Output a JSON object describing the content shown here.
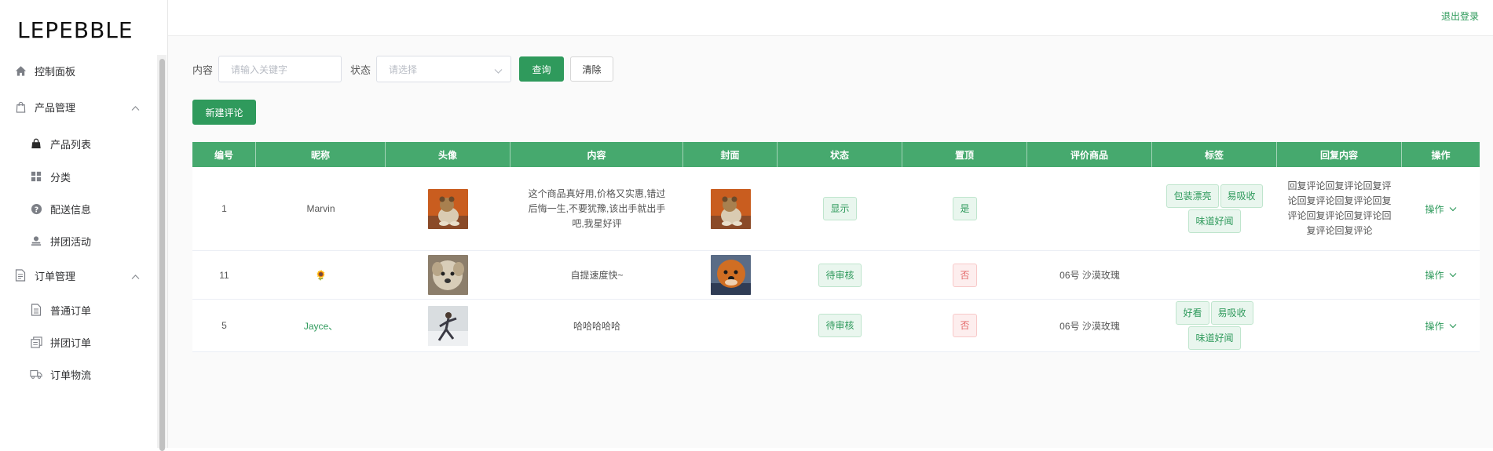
{
  "brand": {
    "logo": "LEPEBBLE"
  },
  "header": {
    "logout": "退出登录"
  },
  "sidebar": {
    "items": [
      {
        "label": "控制面板",
        "icon": "home-icon",
        "kind": "top"
      },
      {
        "label": "产品管理",
        "icon": "bag-icon",
        "kind": "group",
        "expanded": true
      },
      {
        "label": "产品列表",
        "icon": "shopping-bag-icon",
        "kind": "sub",
        "active": true
      },
      {
        "label": "分类",
        "icon": "grid-icon",
        "kind": "sub"
      },
      {
        "label": "配送信息",
        "icon": "question-icon",
        "kind": "sub"
      },
      {
        "label": "拼团活动",
        "icon": "user-icon",
        "kind": "sub"
      },
      {
        "label": "订单管理",
        "icon": "document-icon",
        "kind": "group",
        "expanded": true
      },
      {
        "label": "普通订单",
        "icon": "file-icon",
        "kind": "sub"
      },
      {
        "label": "拼团订单",
        "icon": "files-icon",
        "kind": "sub"
      },
      {
        "label": "订单物流",
        "icon": "truck-icon",
        "kind": "sub"
      }
    ]
  },
  "search": {
    "content_label": "内容",
    "content_placeholder": "请输入关键字",
    "status_label": "状态",
    "status_placeholder": "请选择",
    "query_button": "查询",
    "clear_button": "清除",
    "new_button": "新建评论"
  },
  "table": {
    "columns": [
      "编号",
      "昵称",
      "头像",
      "内容",
      "封面",
      "状态",
      "置顶",
      "评价商品",
      "标签",
      "回复内容",
      "操作"
    ],
    "rows": [
      {
        "id": "1",
        "nickname": "Marvin",
        "avatar": "dog-toy-photo",
        "content": "这个商品真好用,价格又实惠,错过后悔一生,不要犹豫,该出手就出手吧,我星好评",
        "cover": "dog-toy-photo",
        "status": "显示",
        "pinned": "是",
        "product": "",
        "tags": [
          "包装漂亮",
          "易吸收",
          "味道好闻"
        ],
        "reply": "回复评论回复评论回复评论回复评论回复评论回复评论回复评论回复评论回复评论回复评论",
        "op": "操作"
      },
      {
        "id": "11",
        "nickname": "🌻",
        "avatar": "puppy-photo",
        "content": "自提速度快~",
        "cover": "pomeranian-photo",
        "status": "待审核",
        "pinned": "否",
        "product": "06号 沙漠玫瑰",
        "tags": [],
        "reply": "",
        "op": "操作"
      },
      {
        "id": "5",
        "nickname": "Jayce、",
        "avatar": "snow-person-photo",
        "content": "哈哈哈哈哈",
        "cover": "",
        "status": "待审核",
        "pinned": "否",
        "product": "06号 沙漠玫瑰",
        "tags": [
          "好看",
          "易吸收",
          "味道好闻"
        ],
        "reply": "",
        "op": "操作"
      }
    ]
  },
  "colors": {
    "accent": "#2f9a5c",
    "table_header": "#46a96e",
    "danger_tag": "#e46a6a"
  }
}
